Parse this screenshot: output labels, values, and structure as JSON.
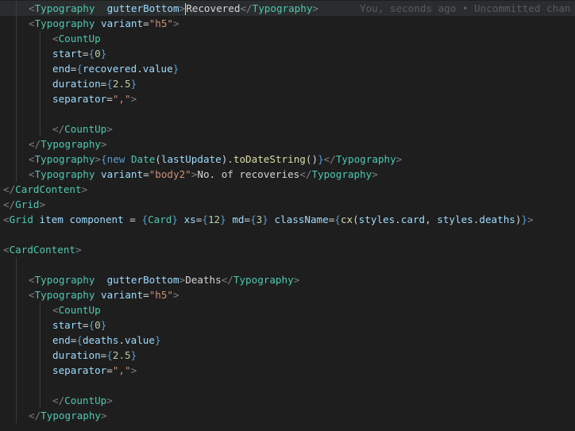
{
  "blame": "You, seconds ago • Uncommitted chan",
  "lines": [
    [
      {
        "t": "<",
        "c": "punct"
      },
      {
        "t": "Typography",
        "c": "tag"
      },
      {
        "t": "  ",
        "c": "text"
      },
      {
        "t": "gutterBottom",
        "c": "attr"
      },
      {
        "t": ">",
        "c": "punct"
      },
      {
        "t": "Recovered",
        "c": "text"
      },
      {
        "t": "</",
        "c": "punct"
      },
      {
        "t": "Typography",
        "c": "tag"
      },
      {
        "t": ">",
        "c": "punct"
      }
    ],
    [
      {
        "t": "<",
        "c": "punct"
      },
      {
        "t": "Typography",
        "c": "tag"
      },
      {
        "t": " ",
        "c": "text"
      },
      {
        "t": "variant",
        "c": "attr"
      },
      {
        "t": "=",
        "c": "op"
      },
      {
        "t": "\"h5\"",
        "c": "str"
      },
      {
        "t": ">",
        "c": "punct"
      }
    ],
    [
      {
        "t": "<",
        "c": "punct"
      },
      {
        "t": "CountUp",
        "c": "tag"
      }
    ],
    [
      {
        "t": "start",
        "c": "attr"
      },
      {
        "t": "=",
        "c": "op"
      },
      {
        "t": "{",
        "c": "brace"
      },
      {
        "t": "0",
        "c": "num"
      },
      {
        "t": "}",
        "c": "brace"
      }
    ],
    [
      {
        "t": "end",
        "c": "attr"
      },
      {
        "t": "=",
        "c": "op"
      },
      {
        "t": "{",
        "c": "brace"
      },
      {
        "t": "recovered",
        "c": "var"
      },
      {
        "t": ".",
        "c": "text"
      },
      {
        "t": "value",
        "c": "var"
      },
      {
        "t": "}",
        "c": "brace"
      }
    ],
    [
      {
        "t": "duration",
        "c": "attr"
      },
      {
        "t": "=",
        "c": "op"
      },
      {
        "t": "{",
        "c": "brace"
      },
      {
        "t": "2.5",
        "c": "num"
      },
      {
        "t": "}",
        "c": "brace"
      }
    ],
    [
      {
        "t": "separator",
        "c": "attr"
      },
      {
        "t": "=",
        "c": "op"
      },
      {
        "t": "\",\"",
        "c": "str"
      },
      {
        "t": ">",
        "c": "punct"
      }
    ],
    [],
    [
      {
        "t": "</",
        "c": "punct"
      },
      {
        "t": "CountUp",
        "c": "tag"
      },
      {
        "t": ">",
        "c": "punct"
      }
    ],
    [
      {
        "t": "</",
        "c": "punct"
      },
      {
        "t": "Typography",
        "c": "tag"
      },
      {
        "t": ">",
        "c": "punct"
      }
    ],
    [
      {
        "t": "<",
        "c": "punct"
      },
      {
        "t": "Typography",
        "c": "tag"
      },
      {
        "t": ">",
        "c": "punct"
      },
      {
        "t": "{",
        "c": "brace"
      },
      {
        "t": "new",
        "c": "keyword"
      },
      {
        "t": " ",
        "c": "text"
      },
      {
        "t": "Date",
        "c": "tag"
      },
      {
        "t": "(",
        "c": "text"
      },
      {
        "t": "lastUpdate",
        "c": "var"
      },
      {
        "t": ").",
        "c": "text"
      },
      {
        "t": "toDateString",
        "c": "fn"
      },
      {
        "t": "()",
        "c": "text"
      },
      {
        "t": "}",
        "c": "brace"
      },
      {
        "t": "</",
        "c": "punct"
      },
      {
        "t": "Typography",
        "c": "tag"
      },
      {
        "t": ">",
        "c": "punct"
      }
    ],
    [
      {
        "t": "<",
        "c": "punct"
      },
      {
        "t": "Typography",
        "c": "tag"
      },
      {
        "t": " ",
        "c": "text"
      },
      {
        "t": "variant",
        "c": "attr"
      },
      {
        "t": "=",
        "c": "op"
      },
      {
        "t": "\"body2\"",
        "c": "str"
      },
      {
        "t": ">",
        "c": "punct"
      },
      {
        "t": "No. of recoveries",
        "c": "text"
      },
      {
        "t": "</",
        "c": "punct"
      },
      {
        "t": "Typography",
        "c": "tag"
      },
      {
        "t": ">",
        "c": "punct"
      }
    ],
    [
      {
        "t": "</",
        "c": "punct"
      },
      {
        "t": "CardContent",
        "c": "tag"
      },
      {
        "t": ">",
        "c": "punct"
      }
    ],
    [
      {
        "t": "</",
        "c": "punct"
      },
      {
        "t": "Grid",
        "c": "tag"
      },
      {
        "t": ">",
        "c": "punct"
      }
    ],
    [
      {
        "t": "<",
        "c": "punct"
      },
      {
        "t": "Grid",
        "c": "tag"
      },
      {
        "t": " ",
        "c": "text"
      },
      {
        "t": "item",
        "c": "attr"
      },
      {
        "t": " ",
        "c": "text"
      },
      {
        "t": "component",
        "c": "attr"
      },
      {
        "t": " = ",
        "c": "op"
      },
      {
        "t": "{",
        "c": "brace"
      },
      {
        "t": "Card",
        "c": "tag"
      },
      {
        "t": "}",
        "c": "brace"
      },
      {
        "t": " ",
        "c": "text"
      },
      {
        "t": "xs",
        "c": "attr"
      },
      {
        "t": "=",
        "c": "op"
      },
      {
        "t": "{",
        "c": "brace"
      },
      {
        "t": "12",
        "c": "num"
      },
      {
        "t": "}",
        "c": "brace"
      },
      {
        "t": " ",
        "c": "text"
      },
      {
        "t": "md",
        "c": "attr"
      },
      {
        "t": "=",
        "c": "op"
      },
      {
        "t": "{",
        "c": "brace"
      },
      {
        "t": "3",
        "c": "num"
      },
      {
        "t": "}",
        "c": "brace"
      },
      {
        "t": " ",
        "c": "text"
      },
      {
        "t": "className",
        "c": "attr"
      },
      {
        "t": "=",
        "c": "op"
      },
      {
        "t": "{",
        "c": "brace"
      },
      {
        "t": "cx",
        "c": "fn"
      },
      {
        "t": "(",
        "c": "text"
      },
      {
        "t": "styles",
        "c": "var"
      },
      {
        "t": ".",
        "c": "text"
      },
      {
        "t": "card",
        "c": "var"
      },
      {
        "t": ", ",
        "c": "text"
      },
      {
        "t": "styles",
        "c": "var"
      },
      {
        "t": ".",
        "c": "text"
      },
      {
        "t": "deaths",
        "c": "var"
      },
      {
        "t": ")",
        "c": "text"
      },
      {
        "t": "}",
        "c": "brace"
      },
      {
        "t": ">",
        "c": "punct"
      }
    ],
    [],
    [
      {
        "t": "<",
        "c": "punct"
      },
      {
        "t": "CardContent",
        "c": "tag"
      },
      {
        "t": ">",
        "c": "punct"
      }
    ],
    [],
    [
      {
        "t": "<",
        "c": "punct"
      },
      {
        "t": "Typography",
        "c": "tag"
      },
      {
        "t": "  ",
        "c": "text"
      },
      {
        "t": "gutterBottom",
        "c": "attr"
      },
      {
        "t": ">",
        "c": "punct"
      },
      {
        "t": "Deaths",
        "c": "text"
      },
      {
        "t": "</",
        "c": "punct"
      },
      {
        "t": "Typography",
        "c": "tag"
      },
      {
        "t": ">",
        "c": "punct"
      }
    ],
    [
      {
        "t": "<",
        "c": "punct"
      },
      {
        "t": "Typography",
        "c": "tag"
      },
      {
        "t": " ",
        "c": "text"
      },
      {
        "t": "variant",
        "c": "attr"
      },
      {
        "t": "=",
        "c": "op"
      },
      {
        "t": "\"h5\"",
        "c": "str"
      },
      {
        "t": ">",
        "c": "punct"
      }
    ],
    [
      {
        "t": "<",
        "c": "punct"
      },
      {
        "t": "CountUp",
        "c": "tag"
      }
    ],
    [
      {
        "t": "start",
        "c": "attr"
      },
      {
        "t": "=",
        "c": "op"
      },
      {
        "t": "{",
        "c": "brace"
      },
      {
        "t": "0",
        "c": "num"
      },
      {
        "t": "}",
        "c": "brace"
      }
    ],
    [
      {
        "t": "end",
        "c": "attr"
      },
      {
        "t": "=",
        "c": "op"
      },
      {
        "t": "{",
        "c": "brace"
      },
      {
        "t": "deaths",
        "c": "var"
      },
      {
        "t": ".",
        "c": "text"
      },
      {
        "t": "value",
        "c": "var"
      },
      {
        "t": "}",
        "c": "brace"
      }
    ],
    [
      {
        "t": "duration",
        "c": "attr"
      },
      {
        "t": "=",
        "c": "op"
      },
      {
        "t": "{",
        "c": "brace"
      },
      {
        "t": "2.5",
        "c": "num"
      },
      {
        "t": "}",
        "c": "brace"
      }
    ],
    [
      {
        "t": "separator",
        "c": "attr"
      },
      {
        "t": "=",
        "c": "op"
      },
      {
        "t": "\",\"",
        "c": "str"
      },
      {
        "t": ">",
        "c": "punct"
      }
    ],
    [],
    [
      {
        "t": "</",
        "c": "punct"
      },
      {
        "t": "CountUp",
        "c": "tag"
      },
      {
        "t": ">",
        "c": "punct"
      }
    ],
    [
      {
        "t": "</",
        "c": "punct"
      },
      {
        "t": "Typography",
        "c": "tag"
      },
      {
        "t": ">",
        "c": "punct"
      }
    ]
  ]
}
